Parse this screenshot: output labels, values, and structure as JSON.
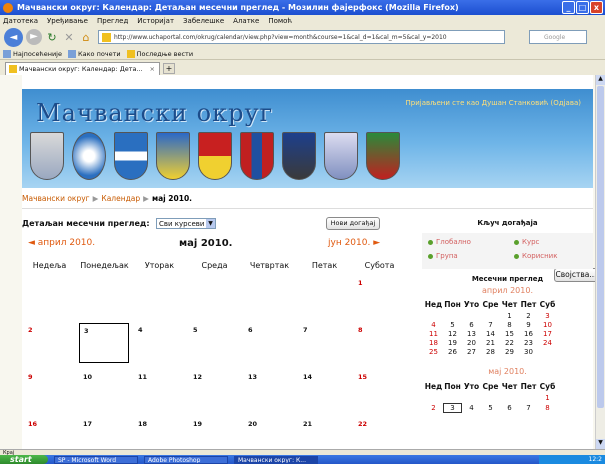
{
  "window": {
    "title": "Мачвански округ: Календар: Детаљан месечни преглед - Мозилин фајерфокс (Mozilla Firefox)",
    "controls": {
      "minimize": "_",
      "maximize": "□",
      "close": "x"
    }
  },
  "menu": [
    "Датотека",
    "Уређивање",
    "Преглед",
    "Историјат",
    "Забелешке",
    "Алатке",
    "Помоћ"
  ],
  "toolbar": {
    "url": "http://www.uchaportal.com/okrug/calendar/view.php?view=month&course=1&cal_d=1&cal_m=5&cal_y=2010",
    "search_placeholder": "Google"
  },
  "bookmarks": [
    "Најпосећеније",
    "Како почети",
    "Последње вести"
  ],
  "tab": {
    "title": "Мачвански округ: Календар: Дета...",
    "close": "×",
    "new": "+"
  },
  "site": {
    "title": "Мачвански округ",
    "login_text": "Пријављени сте као Душан Станковић (Одјава)",
    "breadcrumb": {
      "root": "Мачвански округ",
      "section": "Календар",
      "current": "мај 2010.",
      "sep": "▶"
    },
    "settings_label": "Својства..."
  },
  "calendar": {
    "heading": "Детаљан месечни преглед:",
    "filter_value": "Сви курсеви",
    "new_event_label": "Нови догађај",
    "prev_month": "◄ април 2010.",
    "current_month": "мај 2010.",
    "next_month": "јун 2010. ►",
    "weekdays": [
      "Недеља",
      "Понедељак",
      "Уторак",
      "Среда",
      "Четвртак",
      "Петак",
      "Субота"
    ],
    "weeks": [
      [
        "",
        "",
        "",
        "",
        "",
        "",
        "1"
      ],
      [
        "2",
        "3",
        "4",
        "5",
        "6",
        "7",
        "8"
      ],
      [
        "9",
        "10",
        "11",
        "12",
        "13",
        "14",
        "15"
      ],
      [
        "16",
        "17",
        "18",
        "19",
        "20",
        "21",
        "22"
      ]
    ],
    "selected_day": "3"
  },
  "sidebar": {
    "legend_title": "Кључ догађаја",
    "legend": [
      "Глобално",
      "Курс",
      "Група",
      "Корисник"
    ],
    "mini_title": "Месечни преглед",
    "mini_weekdays": [
      "Нед",
      "Пон",
      "Уто",
      "Сре",
      "Чет",
      "Пет",
      "Суб"
    ],
    "april": {
      "label": "април 2010.",
      "weeks": [
        [
          "",
          "",
          "",
          "",
          "1",
          "2",
          "3"
        ],
        [
          "4",
          "5",
          "6",
          "7",
          "8",
          "9",
          "10"
        ],
        [
          "11",
          "12",
          "13",
          "14",
          "15",
          "16",
          "17"
        ],
        [
          "18",
          "19",
          "20",
          "21",
          "22",
          "23",
          "24"
        ],
        [
          "25",
          "26",
          "27",
          "28",
          "29",
          "30",
          ""
        ]
      ]
    },
    "may": {
      "label": "мај 2010.",
      "weeks": [
        [
          "",
          "",
          "",
          "",
          "",
          "",
          "1"
        ],
        [
          "2",
          "3",
          "4",
          "5",
          "6",
          "7",
          "8"
        ]
      ]
    }
  },
  "statusbar": {
    "text": "Крај"
  },
  "taskbar": {
    "start": "start",
    "tasks": [
      "SP - Microsoft Word",
      "Adobe Photoshop",
      "Мачвански округ: К..."
    ],
    "clock": "12:2"
  },
  "colors": {
    "accent": "#e05a10",
    "header_top": "#3f8ed0",
    "header_bottom": "#a7d4f2",
    "sunday": "#cc0000"
  },
  "icons": {
    "back": "arrow-left-icon",
    "forward": "arrow-right-icon",
    "reload": "reload-icon",
    "stop": "stop-icon",
    "home": "home-icon"
  }
}
